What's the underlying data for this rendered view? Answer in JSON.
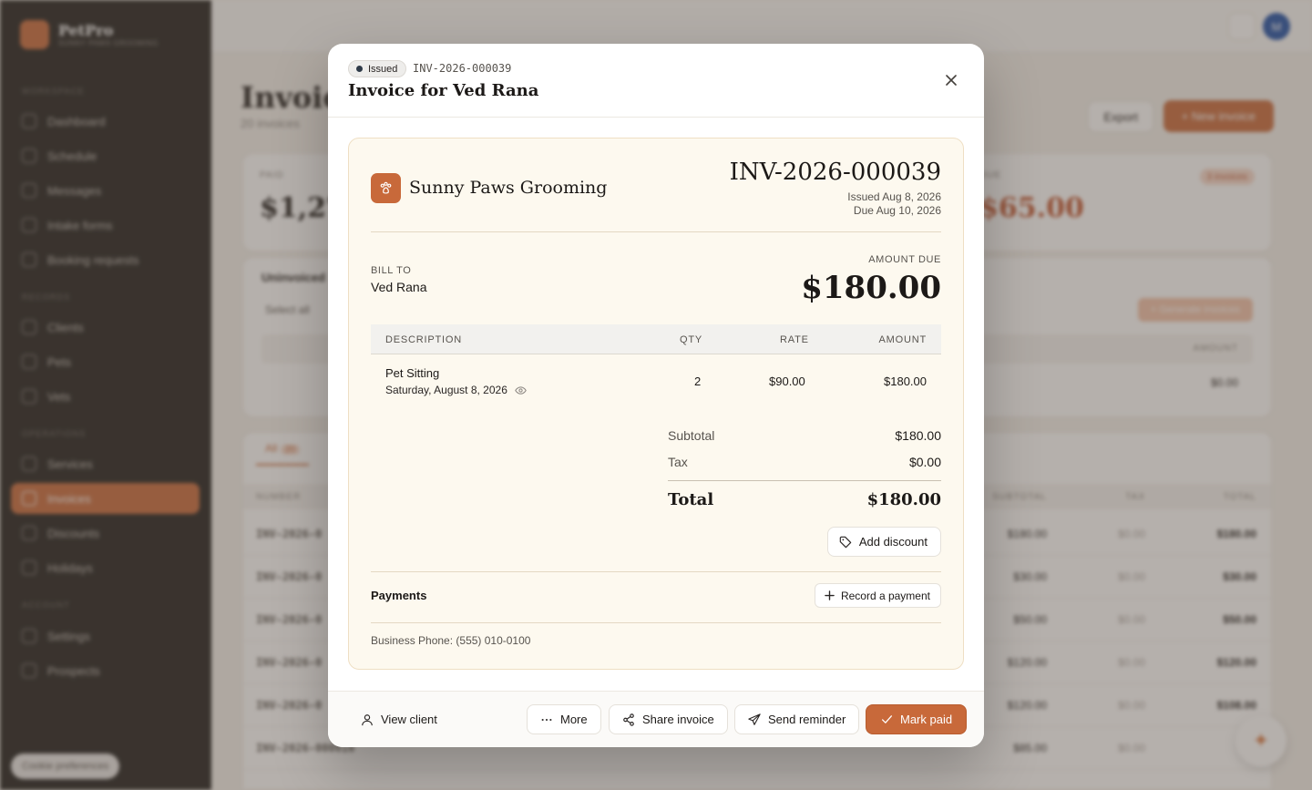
{
  "background": {
    "brand": {
      "name": "PetPro",
      "subtitle": "SUNNY PAWS GROOMING"
    },
    "sidebar": {
      "sections": [
        {
          "label": "WORKSPACE",
          "items": [
            "Dashboard",
            "Schedule",
            "Messages",
            "Intake forms",
            "Booking requests"
          ]
        },
        {
          "label": "RECORDS",
          "items": [
            "Clients",
            "Pets",
            "Vets"
          ]
        },
        {
          "label": "OPERATIONS",
          "items": [
            "Services",
            "Invoices",
            "Discounts",
            "Holidays"
          ]
        },
        {
          "label": "ACCOUNT",
          "items": [
            "Settings",
            "Prospects"
          ]
        }
      ],
      "active": "Invoices",
      "cookie_label": "Cookie preferences"
    },
    "topbar": {
      "avatar_initial": "M"
    },
    "page": {
      "title": "Invoices",
      "subtitle": "20 invoices",
      "export_label": "Export",
      "new_label": "+ New invoice",
      "stat_paid_label": "PAID",
      "stat_paid_value": "$1,276",
      "stat_due_label": "DUE",
      "stat_due_value": "$65.00",
      "stat_due_badge": "3 invoices",
      "uninvoiced_title": "Uninvoiced",
      "select_all": "Select all",
      "generate_label": "+ Generate invoices",
      "uninvoiced_amount_header": "AMOUNT",
      "uninvoiced_amount": "$0.00",
      "tab_all": "All",
      "tab_all_count": "20",
      "table_headers": {
        "number": "NUMBER",
        "subtotal": "SUBTOTAL",
        "tax": "TAX",
        "total": "TOTAL"
      },
      "rows": [
        {
          "number": "INV-2026-0",
          "subtotal": "$180.00",
          "tax": "$0.00",
          "total": "$180.00"
        },
        {
          "number": "INV-2026-0",
          "subtotal": "$30.00",
          "tax": "$0.00",
          "total": "$30.00"
        },
        {
          "number": "INV-2026-0",
          "subtotal": "$50.00",
          "tax": "$0.00",
          "total": "$50.00"
        },
        {
          "number": "INV-2026-0",
          "subtotal": "$120.00",
          "tax": "$0.00",
          "total": "$120.00"
        },
        {
          "number": "INV-2026-0",
          "subtotal": "$120.00",
          "tax": "$0.00",
          "total": "$108.00"
        },
        {
          "number": "INV-2026-000016",
          "subtotal": "$85.00",
          "tax": "$0.00",
          "total": "$85"
        }
      ]
    }
  },
  "modal": {
    "status": "Issued",
    "number": "INV-2026-000039",
    "title": "Invoice for Ved Rana",
    "business_name": "Sunny Paws Grooming",
    "invoice_number": "INV-2026-000039",
    "issued": "Issued Aug 8, 2026",
    "due": "Due Aug 10, 2026",
    "bill_to_label": "BILL TO",
    "bill_to_name": "Ved Rana",
    "amount_due_label": "AMOUNT DUE",
    "amount_due": "$180.00",
    "columns": {
      "description": "DESCRIPTION",
      "qty": "QTY",
      "rate": "RATE",
      "amount": "AMOUNT"
    },
    "line_items": [
      {
        "description": "Pet Sitting",
        "date": "Saturday, August 8, 2026",
        "qty": "2",
        "rate": "$90.00",
        "amount": "$180.00"
      }
    ],
    "subtotal_label": "Subtotal",
    "subtotal": "$180.00",
    "tax_label": "Tax",
    "tax": "$0.00",
    "total_label": "Total",
    "total": "$180.00",
    "add_discount_label": "Add discount",
    "payments_label": "Payments",
    "record_payment_label": "Record a payment",
    "business_phone": "Business Phone: (555) 010-0100",
    "footer": {
      "view_client": "View client",
      "more": "More",
      "share_invoice": "Share invoice",
      "send_reminder": "Send reminder",
      "mark_paid": "Mark paid"
    }
  },
  "colors": {
    "accent": "#c8693a",
    "invoice_bg": "#fdf9ef",
    "sidebar_bg": "#1f1d1b"
  }
}
